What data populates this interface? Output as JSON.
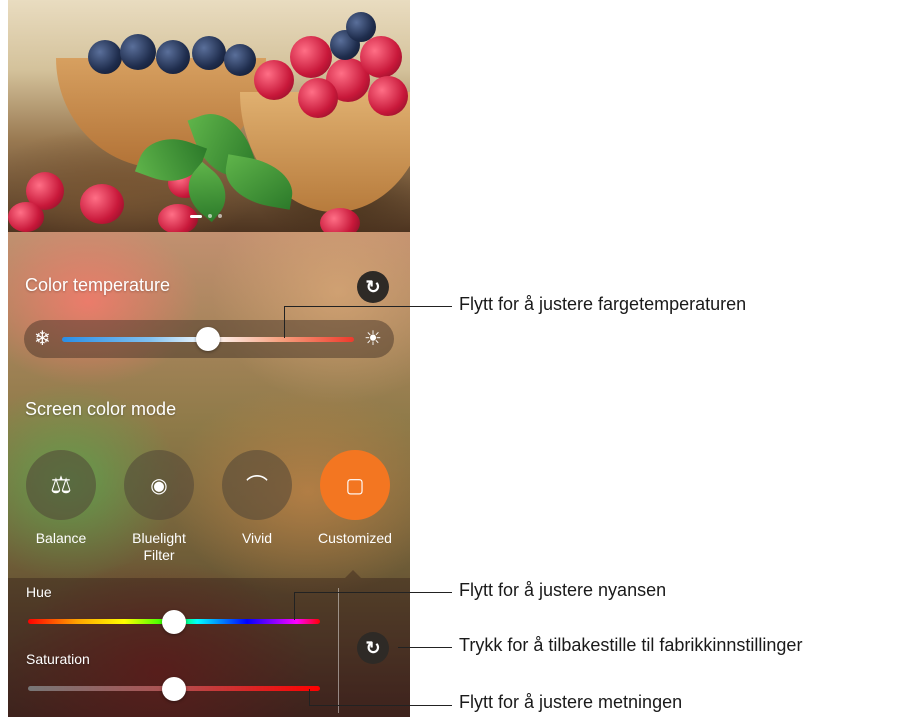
{
  "color_temperature": {
    "title": "Color temperature",
    "cool_icon": "snowflake-icon",
    "warm_icon": "sun-icon",
    "reset_icon": "refresh-icon",
    "slider_value_percent": 50
  },
  "screen_color_mode": {
    "title": "Screen color mode",
    "modes": [
      {
        "label": "Balance",
        "icon": "balance-scale-icon",
        "selected": false
      },
      {
        "label": "Bluelight\nFilter",
        "icon": "eye-shield-icon",
        "selected": false
      },
      {
        "label": "Vivid",
        "icon": "rainbow-icon",
        "selected": false
      },
      {
        "label": "Customized",
        "icon": "custom-screen-icon",
        "selected": true
      }
    ]
  },
  "custom": {
    "hue_label": "Hue",
    "hue_value_percent": 50,
    "saturation_label": "Saturation",
    "saturation_value_percent": 50,
    "reset_icon": "refresh-icon"
  },
  "callouts": {
    "color_temperature": "Flytt for å justere fargetemperaturen",
    "hue": "Flytt for å justere nyansen",
    "reset": "Trykk for å tilbakestille til fabrikkinnstillinger",
    "saturation": "Flytt for å justere metningen"
  },
  "colors": {
    "selected_mode": "#f37621",
    "callout_line": "#222222"
  }
}
